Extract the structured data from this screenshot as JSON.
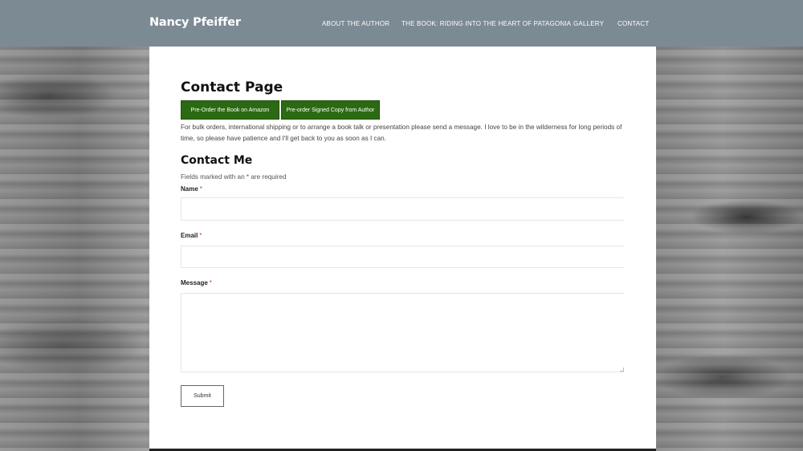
{
  "header": {
    "site_title": "Nancy Pfeiffer",
    "nav": [
      {
        "label": "ABOUT THE AUTHOR"
      },
      {
        "label": "THE BOOK: RIDING INTO THE HEART OF PATAGONIA"
      },
      {
        "label": "GALLERY"
      },
      {
        "label": "CONTACT"
      }
    ]
  },
  "main": {
    "page_title": "Contact Page",
    "buttons": {
      "amazon": "Pre-Order the Book on Amazon",
      "signed": "Pre-order Signed Copy from Author"
    },
    "intro": "For bulk orders, international shipping or to arrange a book talk or presentation please send a message. I love to be in the wilderness for long periods of time, so please have patience and I'll get back to you as soon as I can.",
    "form": {
      "title": "Contact Me",
      "required_note": "Fields marked with an * are required",
      "required_marker": "*",
      "fields": {
        "name": {
          "label": "Name",
          "value": ""
        },
        "email": {
          "label": "Email",
          "value": ""
        },
        "message": {
          "label": "Message",
          "value": ""
        }
      },
      "submit_label": "Submit"
    }
  },
  "colors": {
    "header_bg": "#7c8a93",
    "button_green": "#2b6a12",
    "required_red": "#c0392b"
  }
}
